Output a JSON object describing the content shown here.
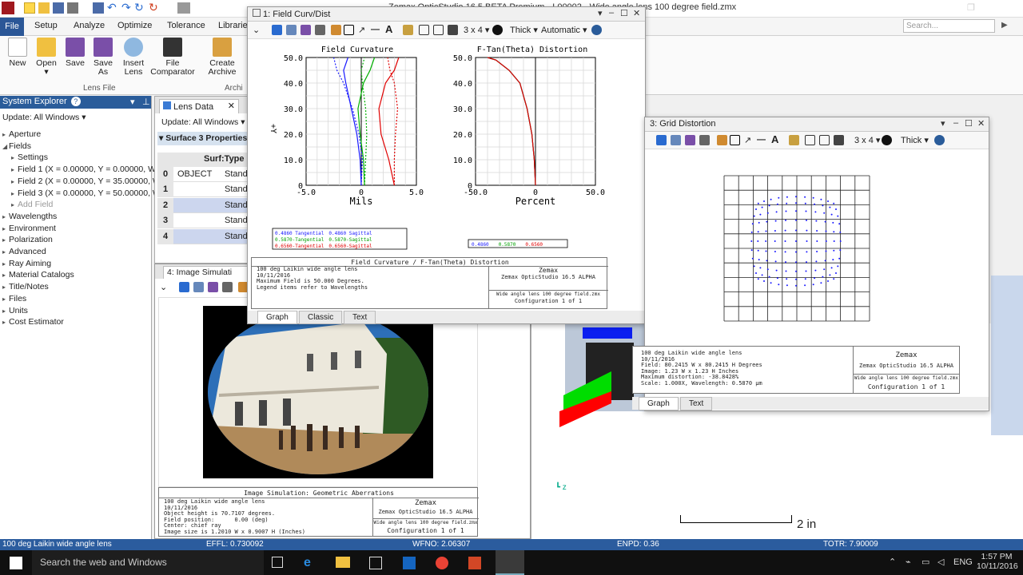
{
  "app": {
    "title": "Zemax OpticStudio 16.5 BETA Premium - L00002 - Wide angle lens 100 degree field.zmx",
    "search_placeholder": "Search..."
  },
  "ribbon_tabs": [
    "File",
    "Setup",
    "Analyze",
    "Optimize",
    "Tolerance",
    "Libraries"
  ],
  "ribbon_buttons": [
    {
      "label": "New",
      "icon": "new-file-icon"
    },
    {
      "label": "Open",
      "icon": "open-folder-icon"
    },
    {
      "label": "Save",
      "icon": "save-icon"
    },
    {
      "label": "Save As",
      "icon": "save-as-icon"
    },
    {
      "label": "Insert Lens",
      "icon": "insert-lens-icon"
    },
    {
      "label": "File Comparator",
      "icon": "file-comparator-icon"
    },
    {
      "label": "Create Archive",
      "icon": "archive-icon"
    }
  ],
  "ribbon_group": "Lens File",
  "ribbon_group2": "Archi",
  "system_explorer": {
    "title": "System Explorer",
    "update": "Update: All Windows",
    "items": [
      {
        "label": "Aperture",
        "level": 0
      },
      {
        "label": "Fields",
        "level": 0,
        "open": true
      },
      {
        "label": "Settings",
        "level": 1
      },
      {
        "label": "Field 1 (X = 0.00000, Y = 0.00000, We",
        "level": 1
      },
      {
        "label": "Field 2 (X = 0.00000, Y = 35.00000, W",
        "level": 1
      },
      {
        "label": "Field 3 (X = 0.00000, Y = 50.00000, W",
        "level": 1
      },
      {
        "label": "Add Field",
        "level": 1,
        "muted": true
      },
      {
        "label": "Wavelengths",
        "level": 0
      },
      {
        "label": "Environment",
        "level": 0
      },
      {
        "label": "Polarization",
        "level": 0
      },
      {
        "label": "Advanced",
        "level": 0
      },
      {
        "label": "Ray Aiming",
        "level": 0
      },
      {
        "label": "Material Catalogs",
        "level": 0
      },
      {
        "label": "Title/Notes",
        "level": 0
      },
      {
        "label": "Files",
        "level": 0
      },
      {
        "label": "Units",
        "level": 0
      },
      {
        "label": "Cost Estimator",
        "level": 0
      }
    ]
  },
  "lens_data": {
    "tab": "Lens Data",
    "update": "Update: All Windows",
    "props": "Surface 3 Properties",
    "col": "Surf:Type",
    "rows": [
      {
        "n": "0",
        "name": "OBJECT",
        "type": "Stand"
      },
      {
        "n": "1",
        "name": "",
        "type": "Stand"
      },
      {
        "n": "2",
        "name": "",
        "type": "Stand"
      },
      {
        "n": "3",
        "name": "",
        "type": "Stand"
      },
      {
        "n": "4",
        "name": "",
        "type": "Stand"
      }
    ]
  },
  "image_sim": {
    "tab": "4: Image Simulati",
    "footer_title": "Image Simulation: Geometric Aberrations",
    "footer_left": "100 deg Laikin wide angle lens\n10/11/2016\nObject height is 70.7107 degrees.\nField position:      0.00 (deg)\nCenter: chief ray\nImage size is 1.2010 W x 0.9007 H (Inches)",
    "footer_right_1": "Zemax",
    "footer_right_2": "Zemax OpticStudio 16.5  ALPHA",
    "footer_right_3": "Wide angle lens 100 degree field.zmx",
    "footer_right_4": "Configuration 1 of 1"
  },
  "field_curv": {
    "title": "1: Field Curv/Dist",
    "toolbar": {
      "grid": "3 x 4",
      "thick": "Thick",
      "auto": "Automatic"
    },
    "left_title": "Field Curvature",
    "right_title": "F-Tan(Theta) Distortion",
    "left_xlabel": "Mils",
    "right_xlabel": "Percent",
    "ylabel": "+Y",
    "left_xticks": [
      "-5.0",
      "0",
      "5.0"
    ],
    "right_xticks": [
      "-50.0",
      "0",
      "50.0"
    ],
    "yticks": [
      "50.0",
      "40.0",
      "30.0",
      "20.0",
      "10.0",
      "0"
    ],
    "left_legend": [
      "0.4860 Tangential",
      "0.4860 Sagittal",
      "0.5870-Tangential",
      "0.5870-Sagittal",
      "0.6560-Tangential",
      "0.6560-Sagittal"
    ],
    "right_legend": [
      "0.4860",
      "0.5870",
      "0.6560"
    ],
    "footer_title": "Field Curvature / F-Tan(Theta) Distortion",
    "footer_left": "100 deg Laikin wide angle lens\n10/11/2016\nMaximum Field is 50.000 Degrees.\nLegend items refer to Wavelengths",
    "footer_right_1": "Zemax",
    "footer_right_2": "Zemax OpticStudio 16.5  ALPHA",
    "footer_right_3": "Wide angle lens 100 degree field.zmx",
    "footer_right_4": "Configuration 1 of 1",
    "tabs": [
      "Graph",
      "Classic",
      "Text"
    ]
  },
  "grid_dist": {
    "title": "3: Grid Distortion",
    "toolbar": {
      "grid": "3 x 4",
      "thick": "Thick"
    },
    "footer_left": "100 deg Laikin wide angle lens\n10/11/2016\nField: 80.2415 W x 80.2415 H Degrees\nImage: 1.23 W x 1.23 H Inches\nMaximum distortion: -38.8428%\nScale: 1.000X, Wavelength: 0.5870 µm",
    "footer_right_1": "Zemax",
    "footer_right_2": "Zemax OpticStudio 16.5  ALPHA",
    "footer_right_3": "Wide angle lens 100 degree field.zmx",
    "footer_right_4": "Configuration 1 of 1",
    "tabs": [
      "Graph",
      "Text"
    ]
  },
  "layout3d": {
    "scale": "2 in"
  },
  "status": {
    "lens": "100 deg Laikin wide angle lens",
    "effl": "EFFL: 0.730092",
    "wfno": "WFNO: 2.06307",
    "enpd": "ENPD: 0.36",
    "totr": "TOTR: 7.90009"
  },
  "taskbar": {
    "search": "Search the web and Windows",
    "time": "1:57 PM",
    "date": "10/11/2016",
    "lang": "ENG"
  },
  "chart_data": [
    {
      "type": "line",
      "title": "Field Curvature",
      "xlabel": "Mils",
      "ylabel": "+Y",
      "xlim": [
        -5,
        5
      ],
      "ylim": [
        0,
        50
      ],
      "series": [
        {
          "name": "0.4860 Tangential",
          "color": "#1a1aff",
          "x": [
            0,
            -0.1,
            -0.4,
            -0.9,
            -1.4,
            -1.6,
            -1.2
          ],
          "y": [
            0,
            10,
            20,
            30,
            40,
            45,
            50
          ]
        },
        {
          "name": "0.4860 Sagittal",
          "color": "#1a1aff",
          "x": [
            0,
            0.1,
            -0.2,
            -0.8,
            -1.6,
            -2.2,
            -2.5
          ],
          "y": [
            0,
            10,
            20,
            30,
            40,
            45,
            50
          ]
        },
        {
          "name": "0.5870-Tangential",
          "color": "#00b000",
          "x": [
            0.3,
            0.2,
            -0.1,
            -0.3,
            0.2,
            0.8,
            1.2
          ],
          "y": [
            0,
            10,
            20,
            30,
            40,
            45,
            50
          ]
        },
        {
          "name": "0.5870-Sagittal",
          "color": "#00b000",
          "x": [
            0.3,
            0.4,
            0.5,
            0.4,
            0.1,
            0,
            0.3
          ],
          "y": [
            0,
            10,
            20,
            30,
            40,
            45,
            50
          ]
        },
        {
          "name": "0.6560-Tangential",
          "color": "#e00000",
          "x": [
            3.0,
            2.5,
            1.8,
            1.6,
            2.2,
            3.0,
            3.4
          ],
          "y": [
            0,
            10,
            20,
            30,
            40,
            45,
            50
          ]
        },
        {
          "name": "0.6560-Sagittal",
          "color": "#e00000",
          "x": [
            3.0,
            3.0,
            3.1,
            3.3,
            3.0,
            2.6,
            2.4
          ],
          "y": [
            0,
            10,
            20,
            30,
            40,
            45,
            50
          ]
        }
      ]
    },
    {
      "type": "line",
      "title": "F-Tan(Theta) Distortion",
      "xlabel": "Percent",
      "ylabel": "",
      "xlim": [
        -50,
        50
      ],
      "ylim": [
        0,
        50
      ],
      "series": [
        {
          "name": "0.4860",
          "color": "#1a1aff",
          "x": [
            0,
            -1,
            -3,
            -7,
            -13,
            -22,
            -33,
            -40
          ],
          "y": [
            0,
            10,
            20,
            30,
            40,
            45,
            49,
            50
          ]
        },
        {
          "name": "0.5870",
          "color": "#00b000",
          "x": [
            0,
            -1,
            -3,
            -7,
            -13,
            -22,
            -33,
            -40
          ],
          "y": [
            0,
            10,
            20,
            30,
            40,
            45,
            49,
            50
          ]
        },
        {
          "name": "0.6560",
          "color": "#e00000",
          "x": [
            0,
            -1,
            -3,
            -7,
            -13,
            -22,
            -33,
            -40
          ],
          "y": [
            0,
            10,
            20,
            30,
            40,
            45,
            49,
            50
          ]
        }
      ]
    }
  ]
}
